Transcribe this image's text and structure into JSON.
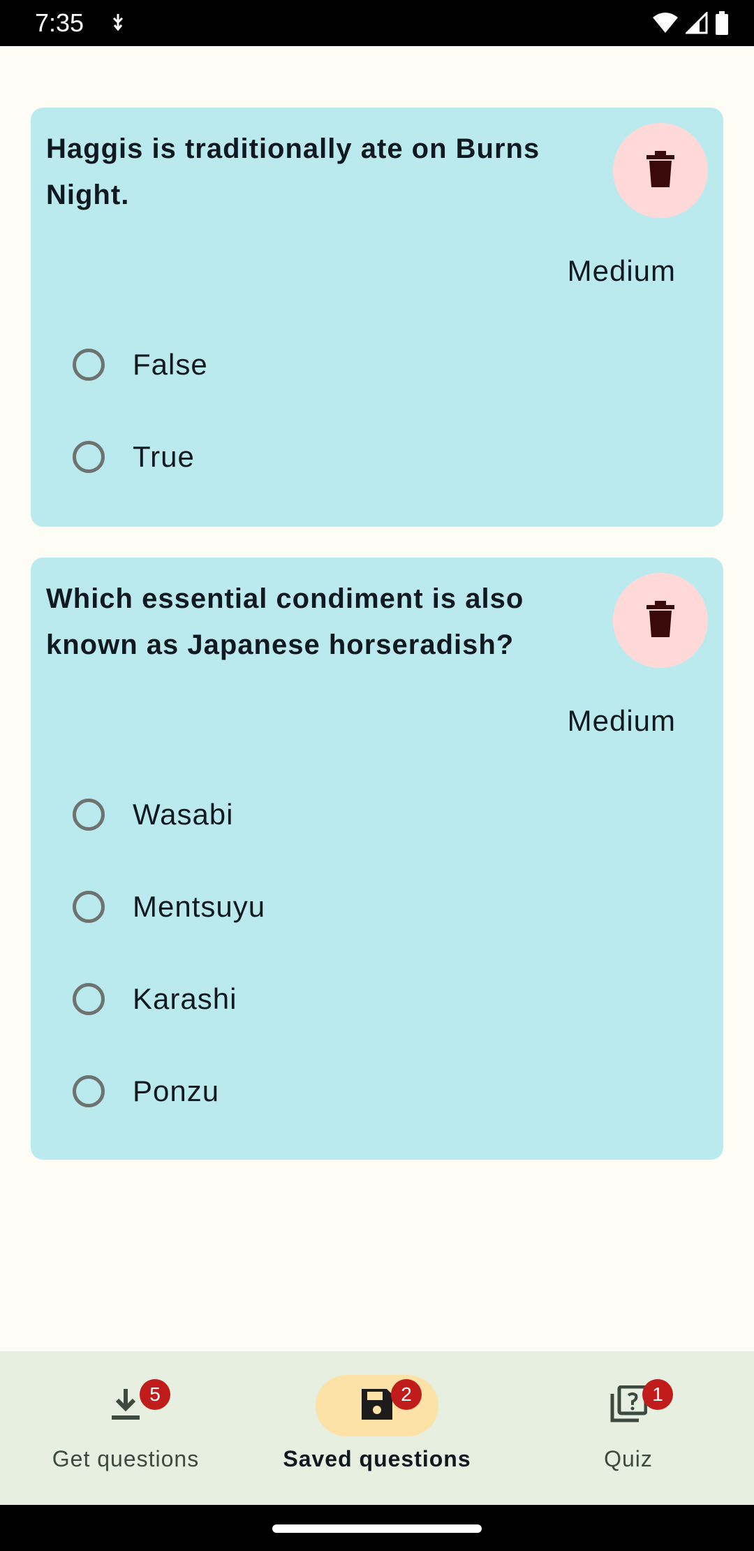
{
  "status_bar": {
    "time": "7:35"
  },
  "cards": [
    {
      "question": "Haggis is traditionally ate on Burns Night.",
      "difficulty": "Medium",
      "options": [
        "False",
        "True"
      ]
    },
    {
      "question": "Which essential condiment is also known as Japanese horseradish?",
      "difficulty": "Medium",
      "options": [
        "Wasabi",
        "Mentsuyu",
        "Karashi",
        "Ponzu"
      ]
    }
  ],
  "bottom_nav": {
    "items": [
      {
        "label": "Get questions",
        "badge": "5",
        "icon": "download-icon",
        "active": false
      },
      {
        "label": "Saved questions",
        "badge": "2",
        "icon": "save-icon",
        "active": true
      },
      {
        "label": "Quiz",
        "badge": "1",
        "icon": "quiz-icon",
        "active": false
      }
    ]
  },
  "colors": {
    "card_background": "#bbeaee",
    "delete_button": "#ffd9d7",
    "active_nav_pill": "#fde2a7",
    "badge": "#c01c1c",
    "nav_background": "#e7efe1"
  }
}
